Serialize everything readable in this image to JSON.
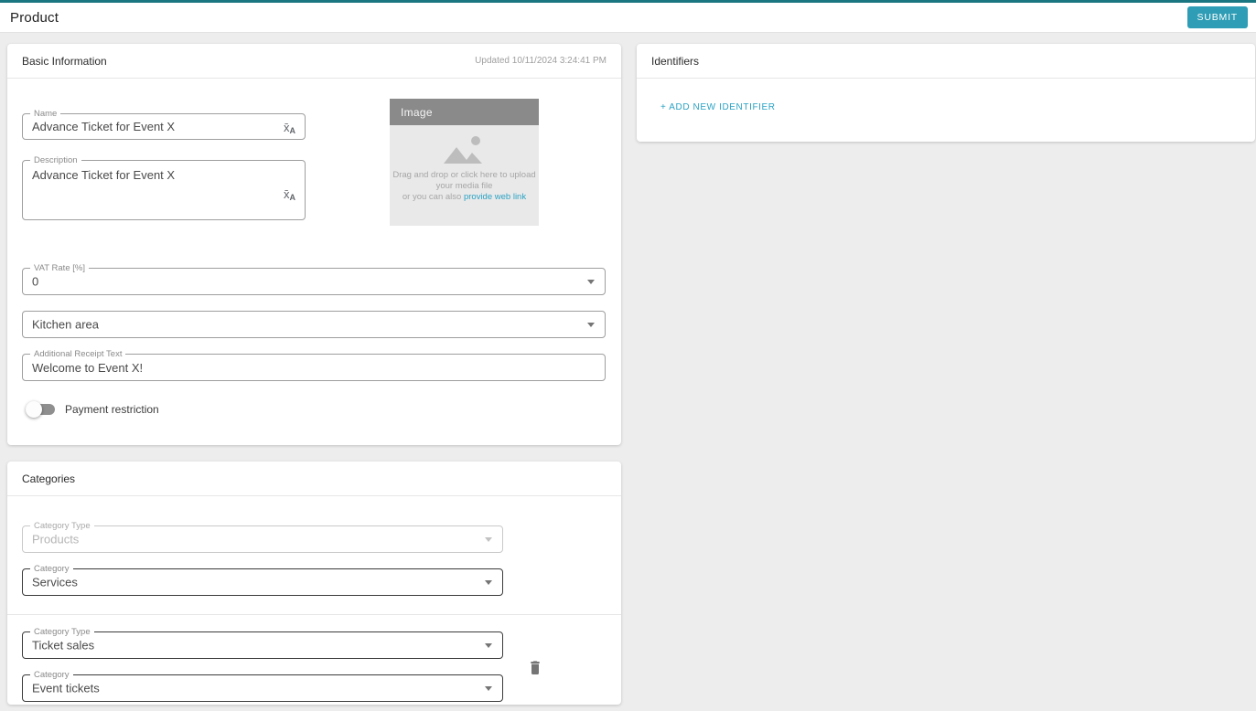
{
  "header": {
    "title": "Product",
    "submit_label": "SUBMIT"
  },
  "colors": {
    "top_strip": "#1a7680",
    "submit_button": "#2e9db5",
    "link_teal": "#2aa3c4",
    "background": "#ededed"
  },
  "icons": {
    "translate_main": "x̄",
    "translate_sub": "A",
    "dropdown_caret": "▾",
    "trash": "trash-can",
    "image_placeholder": "photo-mountains"
  },
  "basic_info": {
    "title": "Basic Information",
    "updated": "Updated 10/11/2024 3:24:41 PM",
    "name": {
      "label": "Name",
      "value": "Advance Ticket for Event X"
    },
    "description": {
      "label": "Description",
      "value": "Advance Ticket for Event X"
    },
    "image": {
      "title": "Image",
      "line1": "Drag and drop or click here to upload",
      "line2": "your media file",
      "line3": "or you can also",
      "link_label": "provide web link"
    },
    "vat": {
      "label": "VAT Rate [%]",
      "value": "0"
    },
    "area": {
      "value": "Kitchen area"
    },
    "receipt": {
      "label": "Additional Receipt Text",
      "value": "Welcome to Event X!"
    },
    "payment_toggle": {
      "label": "Payment restriction",
      "state": "off"
    }
  },
  "categories": {
    "title": "Categories",
    "groups": {
      "0": {
        "type_label": "Category Type",
        "type_value": "Products",
        "cat_label": "Category",
        "cat_value": "Services"
      },
      "1": {
        "type_label": "Category Type",
        "type_value": "Ticket sales",
        "cat_label": "Category",
        "cat_value": "Event tickets"
      }
    }
  },
  "identifiers": {
    "title": "Identifiers",
    "add_label": "+ ADD NEW IDENTIFIER"
  }
}
